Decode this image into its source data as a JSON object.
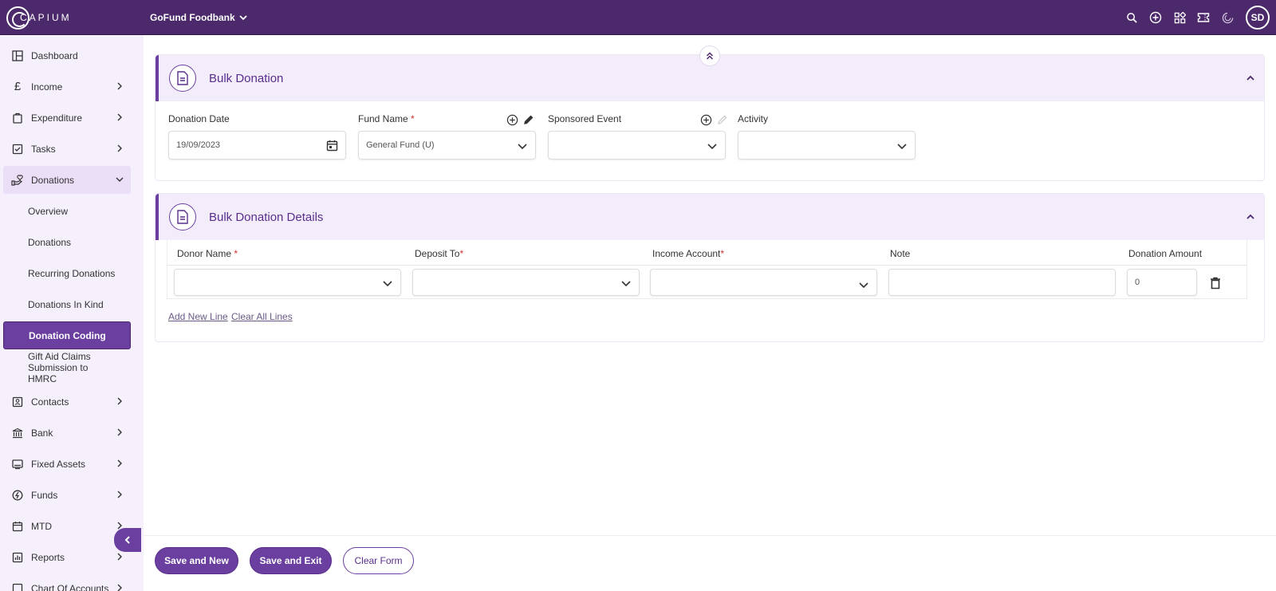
{
  "topbar": {
    "logo_text": "CAPIUM",
    "org_name": "GoFund Foodbank",
    "icons": [
      "search-icon",
      "add-circle-icon",
      "apps-icon",
      "ticket-icon",
      "capium-icon"
    ],
    "avatar_initials": "SD"
  },
  "sidebar": {
    "items": [
      {
        "label": "Dashboard",
        "icon": "dashboard-icon"
      },
      {
        "label": "Income",
        "icon": "pound-icon"
      },
      {
        "label": "Expenditure",
        "icon": "bag-icon"
      },
      {
        "label": "Tasks",
        "icon": "task-icon"
      },
      {
        "label": "Donations",
        "icon": "donation-icon"
      },
      {
        "label": "Contacts",
        "icon": "contacts-icon"
      },
      {
        "label": "Bank",
        "icon": "bank-icon"
      },
      {
        "label": "Fixed Assets",
        "icon": "assets-icon"
      },
      {
        "label": "Funds",
        "icon": "funds-icon"
      },
      {
        "label": "MTD",
        "icon": "calendar-icon"
      },
      {
        "label": "Reports",
        "icon": "reports-icon"
      },
      {
        "label": "Chart Of Accounts",
        "icon": "chart-icon"
      }
    ],
    "donation_subitems": [
      {
        "label": "Overview"
      },
      {
        "label": "Donations"
      },
      {
        "label": "Recurring Donations"
      },
      {
        "label": "Donations In Kind"
      },
      {
        "label": "Donation Coding"
      },
      {
        "label": "Gift Aid Claims Submission to HMRC"
      }
    ]
  },
  "bulk_donation": {
    "title": "Bulk Donation",
    "donation_date_label": "Donation Date",
    "donation_date_value": "19/09/2023",
    "fund_name_label": "Fund Name",
    "fund_name_value": "General Fund (U)",
    "sponsored_event_label": "Sponsored Event",
    "sponsored_event_value": "",
    "activity_label": "Activity",
    "activity_value": "",
    "required_mark": "*"
  },
  "bulk_details": {
    "title": "Bulk Donation Details",
    "columns": {
      "donor_name": "Donor Name",
      "deposit_to": "Deposit To",
      "income_account": "Income Account",
      "note": "Note",
      "donation_amount": "Donation Amount"
    },
    "row": {
      "donor_name": "",
      "deposit_to": "",
      "income_account": "",
      "note": "",
      "donation_amount": "0"
    },
    "add_new_line": "Add New Line",
    "clear_all_lines": "Clear All Lines"
  },
  "footer": {
    "save_new": "Save and New",
    "save_exit": "Save and Exit",
    "clear_form": "Clear Form"
  },
  "colors": {
    "brand": "#4b296b",
    "accent": "#6b3fa0",
    "sidebar_bg": "#f5f0fb",
    "header_bg": "#f3ecfb"
  }
}
